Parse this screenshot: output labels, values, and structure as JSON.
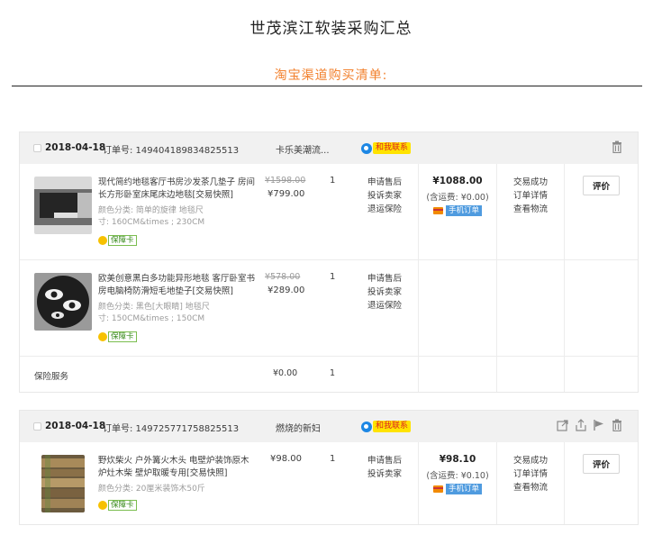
{
  "page": {
    "title": "世茂滨江软装采购汇总",
    "subtitle": "淘宝渠道购买清单:"
  },
  "common": {
    "contact_label": "和我联系",
    "guarantee_label": "保障卡",
    "rate_label": "评价",
    "mobile_order_label": "手机订单",
    "snapshot_label": "[交易快照]"
  },
  "orders": [
    {
      "date": "2018-04-18",
      "order_no": "订单号: 149404189834825513",
      "shop": "卡乐美潮流...",
      "total": "¥1088.00",
      "shipping": "(含运费: ¥0.00)",
      "status": [
        "交易成功",
        "订单详情",
        "查看物流"
      ],
      "items": [
        {
          "name": "现代简约地毯客厅书房沙发茶几垫子 房间长方形卧室床尾床边地毯",
          "spec1": "颜色分类: 简单的旋律 地毯尺",
          "spec2": "寸: 160CM&times ; 230CM",
          "old_price": "¥1598.00",
          "price": "¥799.00",
          "qty": "1",
          "services": [
            "申请售后",
            "投诉卖家",
            "退运保险"
          ]
        },
        {
          "name": "欧美创意黑白多功能异形地毯 客厅卧室书房电脑椅防滑短毛地垫子",
          "spec1": "颜色分类: 黑色[大眼睛] 地毯尺",
          "spec2": "寸: 150CM&times ; 150CM",
          "old_price": "¥578.00",
          "price": "¥289.00",
          "qty": "1",
          "services": [
            "申请售后",
            "投诉卖家",
            "退运保险"
          ]
        }
      ],
      "insurance": {
        "name": "保险服务",
        "price": "¥0.00",
        "qty": "1"
      }
    },
    {
      "date": "2018-04-18",
      "order_no": "订单号: 149725771758825513",
      "shop": "燃烧的新妇",
      "total": "¥98.10",
      "shipping": "(含运费: ¥0.10)",
      "status": [
        "交易成功",
        "订单详情",
        "查看物流"
      ],
      "items": [
        {
          "name": "野炊柴火 户外篝火木头 电壁炉装饰原木炉灶木柴 壁炉取暖专用",
          "spec1": "颜色分类: 20厘米装饰木50斤",
          "price": "¥98.00",
          "qty": "1",
          "services": [
            "申请售后",
            "投诉卖家"
          ]
        }
      ]
    }
  ],
  "icons": {
    "trash": "trash-icon",
    "share": "share-icon",
    "upload": "upload-icon",
    "flag": "flag-icon"
  }
}
